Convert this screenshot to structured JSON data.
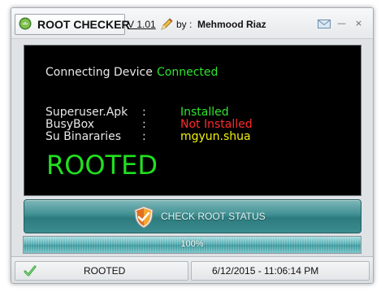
{
  "titlebar": {
    "app_title": "ROOT CHECKER",
    "version": "V 1.01",
    "by_label": "by :",
    "author": "Mehmood Riaz",
    "icons": {
      "app": "android-icon",
      "pen": "pen-icon",
      "mail": "mail-icon",
      "minimize": "minimize-icon",
      "close": "close-icon"
    },
    "minimize_glyph": "—",
    "close_glyph": "×"
  },
  "console": {
    "connecting_label": "Connecting Device",
    "connecting_value": "Connected",
    "rows": [
      {
        "label": "Superuser.Apk",
        "sep": ":",
        "value": "Installed",
        "color": "#2ee52e"
      },
      {
        "label": "BusyBox",
        "sep": ":",
        "value": "Not Installed",
        "color": "#ff2a2a"
      },
      {
        "label": "Su Binararies",
        "sep": ":",
        "value": "mgyun.shua",
        "color": "#f2f20e"
      }
    ],
    "result": "ROOTED"
  },
  "check_button": {
    "label": "CHECK ROOT STATUS",
    "icon": "shield-icon"
  },
  "progress": {
    "value": 1.0,
    "label": "100%"
  },
  "statusbar": {
    "status": "ROOTED",
    "datetime": "6/12/2015  -  11:06:14 PM",
    "icon": "check-icon"
  },
  "colors": {
    "console_bg": "#000000",
    "ok_green": "#2ee52e",
    "error_red": "#ff2a2a",
    "warn_yellow": "#f2f20e",
    "button_teal": "#3f8f92"
  }
}
